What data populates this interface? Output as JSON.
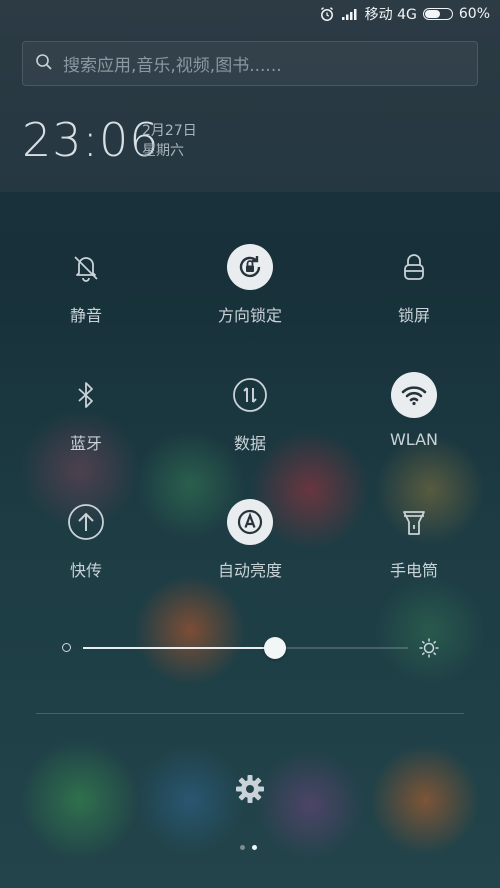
{
  "status_bar": {
    "carrier": "移动 4G",
    "battery_percent": "60%",
    "battery_level": 0.6,
    "icons": [
      "alarm-icon",
      "signal-icon",
      "battery-icon"
    ]
  },
  "search": {
    "placeholder": "搜索应用,音乐,视频,图书......"
  },
  "clock": {
    "time": "23:06",
    "date": "2月27日",
    "weekday": "星期六"
  },
  "toggles": [
    {
      "label": "静音",
      "icon": "bell-off-icon",
      "on": false
    },
    {
      "label": "方向锁定",
      "icon": "rotation-lock-icon",
      "on": true
    },
    {
      "label": "锁屏",
      "icon": "lock-icon",
      "on": false
    },
    {
      "label": "蓝牙",
      "icon": "bluetooth-icon",
      "on": false
    },
    {
      "label": "数据",
      "icon": "data-icon",
      "on": false
    },
    {
      "label": "WLAN",
      "icon": "wifi-icon",
      "on": true
    },
    {
      "label": "快传",
      "icon": "upload-icon",
      "on": false
    },
    {
      "label": "自动亮度",
      "icon": "auto-brightness-icon",
      "on": true
    },
    {
      "label": "手电筒",
      "icon": "flashlight-icon",
      "on": false
    }
  ],
  "brightness": {
    "level": 0.59
  },
  "pager": {
    "pages": 2,
    "current": 2
  },
  "colors": {
    "active_toggle": "#e9edef",
    "text": "#c9d2d7"
  }
}
